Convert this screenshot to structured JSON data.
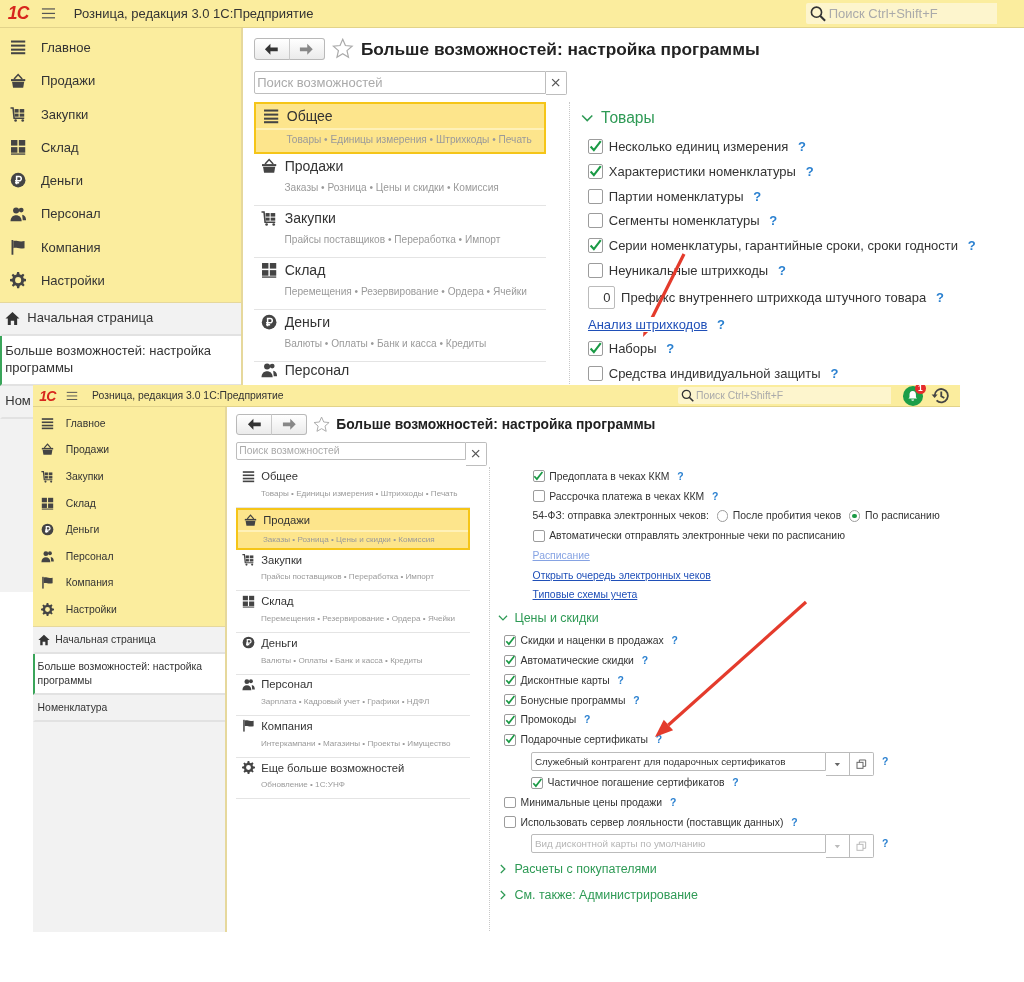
{
  "windows": [
    {
      "logo": "1С",
      "title": "Розница, редакция 3.0 1С:Предприятие",
      "search": {
        "placeholder": "Поиск Ctrl+Shift+F"
      },
      "sections": [
        "Главное",
        "Продажи",
        "Закупки",
        "Склад",
        "Деньги",
        "Персонал",
        "Компания",
        "Настройки"
      ],
      "open_pages": [
        {
          "label": "Начальная страница",
          "kind": "home",
          "selected": false
        },
        {
          "label": "Больше возможностей: настройка программы",
          "kind": "page",
          "selected": true
        },
        {
          "label": "Ном",
          "kind": "page",
          "selected": false
        }
      ],
      "page": {
        "title": "Больше возможностей: настройка программы",
        "search": {
          "placeholder": "Поиск возможностей"
        },
        "categories": [
          {
            "title": "Общее",
            "subtitle": "Товары • Единицы измерения • Штрихкоды • Печать",
            "selected": true
          },
          {
            "title": "Продажи",
            "subtitle": "Заказы • Розница • Цены и скидки • Комиссия",
            "selected": false
          },
          {
            "title": "Закупки",
            "subtitle": "Прайсы поставщиков • Переработка • Импорт",
            "selected": false
          },
          {
            "title": "Склад",
            "subtitle": "Перемещения • Резервирование • Ордера • Ячейки",
            "selected": false
          },
          {
            "title": "Деньги",
            "subtitle": "Валюты • Оплаты • Банк и касса • Кредиты",
            "selected": false
          },
          {
            "title": "Персонал",
            "selected": false
          }
        ],
        "settings": [
          {
            "title": "Товары",
            "expanded": true,
            "items": [
              {
                "kind": "checkbox",
                "label": "Несколько единиц измерения",
                "checked": true,
                "help": "?"
              },
              {
                "kind": "checkbox",
                "label": "Характеристики номенклатуры",
                "checked": true,
                "help": "?"
              },
              {
                "kind": "checkbox",
                "label": "Партии номенклатуры",
                "checked": false,
                "help": "?"
              },
              {
                "kind": "checkbox",
                "label": "Сегменты номенклатуры",
                "checked": false,
                "help": "?"
              },
              {
                "kind": "checkbox",
                "label": "Серии номенклатуры, гарантийные сроки, сроки годности",
                "checked": true,
                "help": "?"
              },
              {
                "kind": "checkbox",
                "label": "Неуникальные штрихкоды",
                "checked": false,
                "help": "?"
              },
              {
                "kind": "number",
                "value": "0",
                "label": "Префикс внутреннего штрихкода штучного товара",
                "help": "?"
              },
              {
                "kind": "link",
                "label": "Анализ штрихкодов",
                "disabled": false,
                "help": "?"
              },
              {
                "kind": "checkbox",
                "label": "Наборы",
                "checked": true,
                "help": "?"
              },
              {
                "kind": "checkbox",
                "label": "Средства индивидуальной защиты",
                "checked": false,
                "help": "?"
              }
            ]
          }
        ]
      }
    },
    {
      "logo": "1С",
      "title": "Розница, редакция 3.0 1С:Предприятие",
      "search": {
        "placeholder": "Поиск Ctrl+Shift+F"
      },
      "notifications": {
        "count": "1"
      },
      "history": true,
      "sections": [
        "Главное",
        "Продажи",
        "Закупки",
        "Склад",
        "Деньги",
        "Персонал",
        "Компания",
        "Настройки"
      ],
      "open_pages": [
        {
          "label": "Начальная страница",
          "kind": "home",
          "selected": false
        },
        {
          "label": "Больше возможностей: настройка программы",
          "kind": "page",
          "selected": true
        },
        {
          "label": "Номенклатура",
          "kind": "page",
          "selected": false
        }
      ],
      "page": {
        "title": "Больше возможностей: настройка программы",
        "search": {
          "placeholder": "Поиск возможностей"
        },
        "categories": [
          {
            "title": "Общее",
            "subtitle": "Товары • Единицы измерения • Штрихкоды • Печать",
            "selected": false
          },
          {
            "title": "Продажи",
            "subtitle": "Заказы • Розница • Цены и скидки • Комиссия",
            "selected": true
          },
          {
            "title": "Закупки",
            "subtitle": "Прайсы поставщиков • Переработка • Импорт",
            "selected": false
          },
          {
            "title": "Склад",
            "subtitle": "Перемещения • Резервирование • Ордера • Ячейки",
            "selected": false
          },
          {
            "title": "Деньги",
            "subtitle": "Валюты • Оплаты • Банк и касса • Кредиты",
            "selected": false
          },
          {
            "title": "Персонал",
            "subtitle": "Зарплата • Кадровый учет • Графики • НДФЛ",
            "selected": false
          },
          {
            "title": "Компания",
            "subtitle": "Интеркампани • Магазины • Проекты • Имущество",
            "selected": false
          },
          {
            "title": "Еще больше возможностей",
            "subtitle": "Обновление • 1С:УНФ",
            "selected": false
          }
        ],
        "settings": [
          {
            "items": [
              {
                "kind": "checkbox",
                "label": "Предоплата в чеках ККМ",
                "checked": true,
                "help": "?"
              },
              {
                "kind": "checkbox",
                "label": "Рассрочка платежа в чеках ККМ",
                "checked": false,
                "help": "?"
              },
              {
                "kind": "radio",
                "label": "54-ФЗ: отправка электронных чеков:",
                "options": [
                  {
                    "label": "После пробития чеков",
                    "selected": false
                  },
                  {
                    "label": "По расписанию",
                    "selected": true
                  }
                ]
              },
              {
                "kind": "checkbox",
                "label": "Автоматически отправлять электронные чеки по расписанию",
                "checked": false
              },
              {
                "kind": "link",
                "label": "Расписание",
                "disabled": true
              },
              {
                "kind": "link",
                "label": "Открыть очередь электронных чеков",
                "disabled": false
              },
              {
                "kind": "link",
                "label": "Типовые схемы учета",
                "disabled": false
              }
            ]
          },
          {
            "title": "Цены и скидки",
            "expanded": true,
            "items": [
              {
                "kind": "checkbox",
                "label": "Скидки и наценки в продажах",
                "checked": true,
                "help": "?"
              },
              {
                "kind": "checkbox",
                "label": "Автоматические скидки",
                "checked": true,
                "help": "?"
              },
              {
                "kind": "checkbox",
                "label": "Дисконтные карты",
                "checked": true,
                "help": "?"
              },
              {
                "kind": "checkbox",
                "label": "Бонусные программы",
                "checked": true,
                "help": "?"
              },
              {
                "kind": "checkbox",
                "label": "Промокоды",
                "checked": true,
                "help": "?"
              },
              {
                "kind": "checkbox",
                "label": "Подарочные сертификаты",
                "checked": true,
                "help": "?",
                "children": [
                  {
                    "kind": "combo",
                    "value": "Служебный контрагент для подарочных сертификатов",
                    "disabled": false,
                    "help": "?"
                  },
                  {
                    "kind": "checkbox",
                    "label": "Частичное погашение сертификатов",
                    "checked": true,
                    "help": "?"
                  }
                ]
              },
              {
                "kind": "checkbox",
                "label": "Минимальные цены продажи",
                "checked": false,
                "help": "?"
              },
              {
                "kind": "checkbox",
                "label": "Использовать сервер лояльности (поставщик данных)",
                "checked": false,
                "help": "?",
                "children": [
                  {
                    "kind": "combo",
                    "placeholder": "Вид дисконтной карты по умолчанию",
                    "disabled": true,
                    "help": "?"
                  }
                ]
              }
            ]
          },
          {
            "title": "Расчеты с покупателями",
            "expanded": false
          },
          {
            "title": "См. также: Администрирование",
            "expanded": false
          }
        ]
      }
    }
  ]
}
